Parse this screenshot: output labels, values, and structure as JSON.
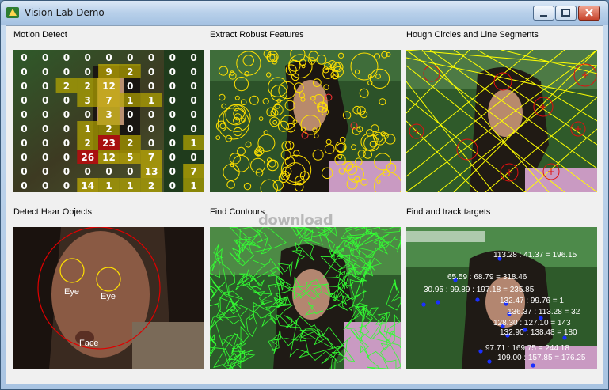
{
  "window": {
    "title": "Vision Lab Demo",
    "controls": {
      "minimize": "minimize",
      "maximize": "maximize",
      "close": "close"
    }
  },
  "panels": {
    "motion": {
      "label": "Motion Detect"
    },
    "features": {
      "label": "Extract Robust Features"
    },
    "hough": {
      "label": "Hough Circles and Line Segments"
    },
    "haar": {
      "label": "Detect Haar Objects",
      "eye_left": "Eye",
      "eye_right": "Eye",
      "face": "Face"
    },
    "contours": {
      "label": "Find Contours"
    },
    "tracking": {
      "label": "Find and track targets",
      "readouts": [
        "113.28 : 41.37 = 196.15",
        "65.59 : 68.79 = 318.46",
        "30.95 : 99.89 : 197.18 = 235.85",
        "132.47 : 99.76 = 1",
        "136.37 : 113.28 = 32",
        "128.30 : 127.10 = 143",
        "132.90 : 138.48 = 180",
        "97.71 : 169.75 = 244.18",
        "109.00 : 157.85 = 176.25"
      ]
    }
  },
  "motion_grid": [
    [
      "0",
      "0",
      "0",
      "0",
      "0",
      "0",
      "0",
      "0",
      "0"
    ],
    [
      "0",
      "0",
      "0",
      "0",
      "9",
      "2",
      "0",
      "0",
      "0"
    ],
    [
      "0",
      "0",
      "2",
      "2",
      "12",
      "0",
      "0",
      "0",
      "0"
    ],
    [
      "0",
      "0",
      "0",
      "3",
      "7",
      "1",
      "1",
      "0",
      "0"
    ],
    [
      "0",
      "0",
      "0",
      "0",
      "3",
      "0",
      "0",
      "0",
      "0"
    ],
    [
      "0",
      "0",
      "0",
      "1",
      "2",
      "0",
      "0",
      "0",
      "0"
    ],
    [
      "0",
      "0",
      "0",
      "2",
      "23",
      "2",
      "0",
      "0",
      "1"
    ],
    [
      "0",
      "0",
      "0",
      "26",
      "12",
      "5",
      "7",
      "0",
      "0"
    ],
    [
      "0",
      "0",
      "0",
      "0",
      "0",
      "0",
      "13",
      "0",
      "7"
    ],
    [
      "0",
      "0",
      "0",
      "14",
      "1",
      "1",
      "2",
      "0",
      "1"
    ]
  ],
  "watermark": "download"
}
